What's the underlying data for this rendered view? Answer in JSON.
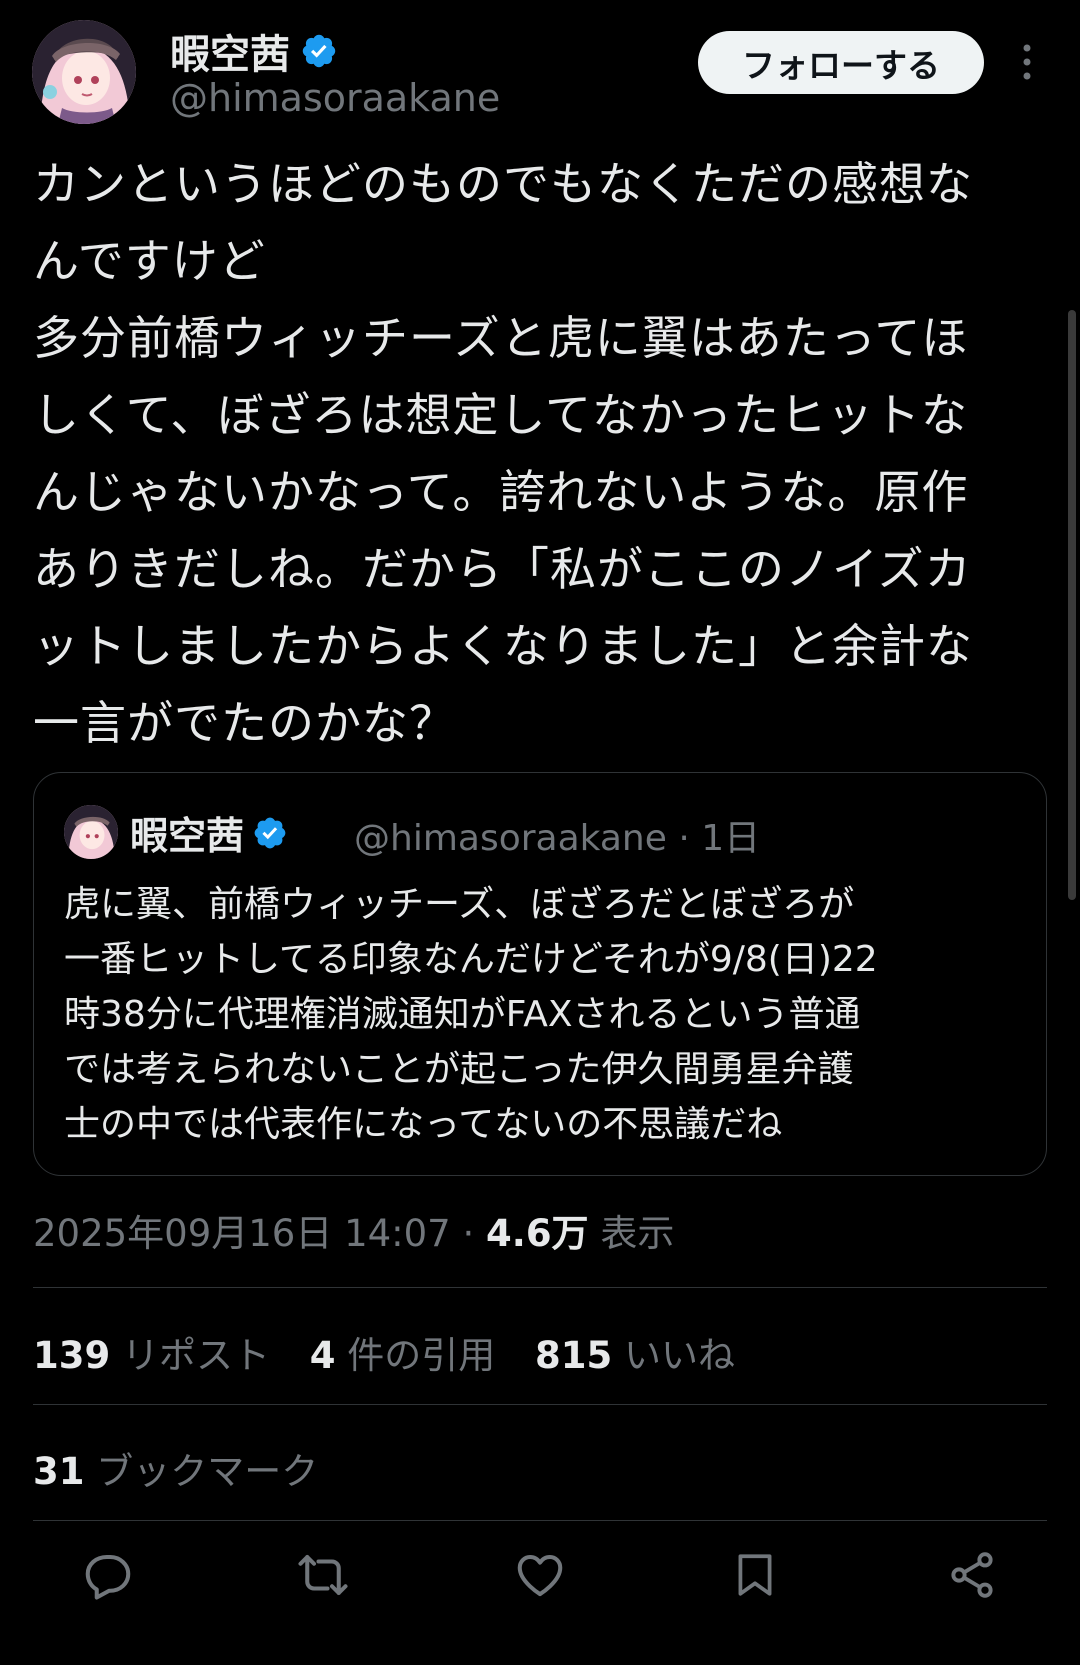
{
  "author": {
    "display_name": "暇空茜",
    "handle": "@himasoraakane",
    "verified_color": "#1d9bf0"
  },
  "header": {
    "follow_label": "フォローする",
    "more_icon": "more-vertical-icon"
  },
  "tweet": {
    "lines": [
      "カンというほどのものでもなくただの感想な",
      "んですけど",
      "多分前橋ウィッチーズと虎に翼はあたってほ",
      "しくて、ぼざろは想定してなかったヒットな",
      "んじゃないかなって。誇れないような。原作",
      "ありきだしね。だから「私がここのノイズカ",
      "ットしましたからよくなりました」と余計な",
      "一言がでたのかな？"
    ]
  },
  "quote": {
    "display_name": "暇空茜",
    "handle_time": "@himasoraakane · 1日",
    "lines": [
      "虎に翼、前橋ウィッチーズ、ぼざろだとぼざろが",
      "一番ヒットしてる印象なんだけどそれが9/8(日)22",
      "時38分に代理権消滅通知がFAXされるという普通",
      "では考えられないことが起こった伊久間勇星弁護",
      "士の中では代表作になってないの不思議だね"
    ]
  },
  "meta": {
    "timestamp": "2025年09月16日 14:07",
    "separator": " · ",
    "views_count": "4.6万",
    "views_label": " 表示"
  },
  "stats": {
    "reposts_count": "139",
    "reposts_label": " リポスト",
    "quotes_count": "4",
    "quotes_label": " 件の引用",
    "likes_count": "815",
    "likes_label": " いいね",
    "bookmarks_count": "31",
    "bookmarks_label": " ブックマーク"
  },
  "actions": [
    "reply-icon",
    "repost-icon",
    "like-icon",
    "bookmark-icon",
    "share-icon"
  ]
}
